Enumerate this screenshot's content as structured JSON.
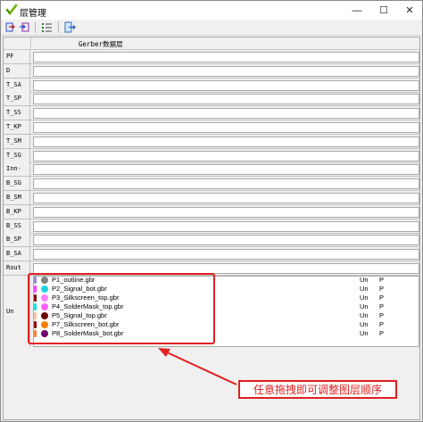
{
  "window": {
    "title": "层管理",
    "minimize_glyph": "—",
    "maximize_glyph": "☐",
    "close_glyph": "✕"
  },
  "toolbar": {
    "icons": [
      "import-icon",
      "export-icon",
      "list-icon",
      "exit-icon"
    ]
  },
  "grid": {
    "column_header": "Gerber数据层",
    "rows": [
      {
        "label": "PF"
      },
      {
        "label": "D"
      },
      {
        "label": "T_SA"
      },
      {
        "label": "T_SP"
      },
      {
        "label": "T_SS"
      },
      {
        "label": "T_KP"
      },
      {
        "label": "T_SM"
      },
      {
        "label": "T_SG"
      },
      {
        "label": "Inn",
        "suffix": "-"
      },
      {
        "label": "B_SG"
      },
      {
        "label": "B_SM"
      },
      {
        "label": "B_KP"
      },
      {
        "label": "B_SS"
      },
      {
        "label": "B_SP"
      },
      {
        "label": "B_SA"
      },
      {
        "label": "Rout"
      }
    ],
    "unassigned_label": "Un"
  },
  "layers": [
    {
      "name": "P1_outline.gbr",
      "bar": "#9090d0",
      "dot": "#808080",
      "state": "Un",
      "flag": "P"
    },
    {
      "name": "P2_Signal_bot.gbr",
      "bar": "#ff40ff",
      "dot": "#20d0e0",
      "state": "Un",
      "flag": "P"
    },
    {
      "name": "P3_Silkscreen_top.gbr",
      "bar": "#800000",
      "dot": "#ff80ff",
      "state": "Un",
      "flag": "P"
    },
    {
      "name": "P4_SolderMask_top.gbr",
      "bar": "#20e0e0",
      "dot": "#ff60ff",
      "state": "Un",
      "flag": "P"
    },
    {
      "name": "P5_Signal_top.gbr",
      "bar": "#ffc0a0",
      "dot": "#700000",
      "state": "Un",
      "flag": "P"
    },
    {
      "name": "P7_Silkscreen_bot.gbr",
      "bar": "#900000",
      "dot": "#ff8000",
      "state": "Un",
      "flag": "P"
    },
    {
      "name": "P8_SolderMask_bot.gbr",
      "bar": "#ff8040",
      "dot": "#700070",
      "state": "Un",
      "flag": "P"
    }
  ],
  "annotation": {
    "callout_text": "任意拖拽即可调整图层顺序",
    "color": "#e02020"
  }
}
